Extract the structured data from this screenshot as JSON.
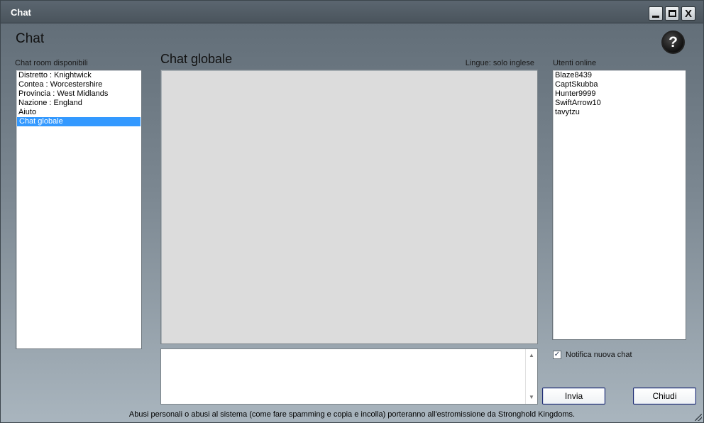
{
  "window": {
    "title": "Chat",
    "minimize_icon": "minimize-icon",
    "maximize_icon": "maximize-icon",
    "close_label": "X"
  },
  "header": {
    "title": "Chat",
    "help_label": "?"
  },
  "rooms": {
    "label": "Chat room disponibili",
    "items": [
      {
        "label": "Distretto : Knightwick",
        "selected": false
      },
      {
        "label": "Contea : Worcestershire",
        "selected": false
      },
      {
        "label": "Provincia : West Midlands",
        "selected": false
      },
      {
        "label": "Nazione : England",
        "selected": false
      },
      {
        "label": "Aiuto",
        "selected": false
      },
      {
        "label": "Chat globale",
        "selected": true
      }
    ]
  },
  "chat": {
    "title": "Chat globale",
    "language_label": "Lingue: solo inglese",
    "input_value": ""
  },
  "users": {
    "label": "Utenti online",
    "items": [
      "Blaze8439",
      "CaptSkubba",
      "Hunter9999",
      "SwiftArrow10",
      "tavytzu"
    ]
  },
  "notify": {
    "label": "Notifica nuova chat",
    "checked": true,
    "check_glyph": "✓"
  },
  "buttons": {
    "send": "Invia",
    "close": "Chiudi"
  },
  "footer": {
    "text": "Abusi personali o abusi al sistema (come fare spamming e copia e incolla) porteranno all'estromissione da Stronghold Kingdoms."
  },
  "colors": {
    "selection": "#3399ff",
    "chat_background": "#dcdcdc",
    "button_border": "#1d2a73"
  }
}
